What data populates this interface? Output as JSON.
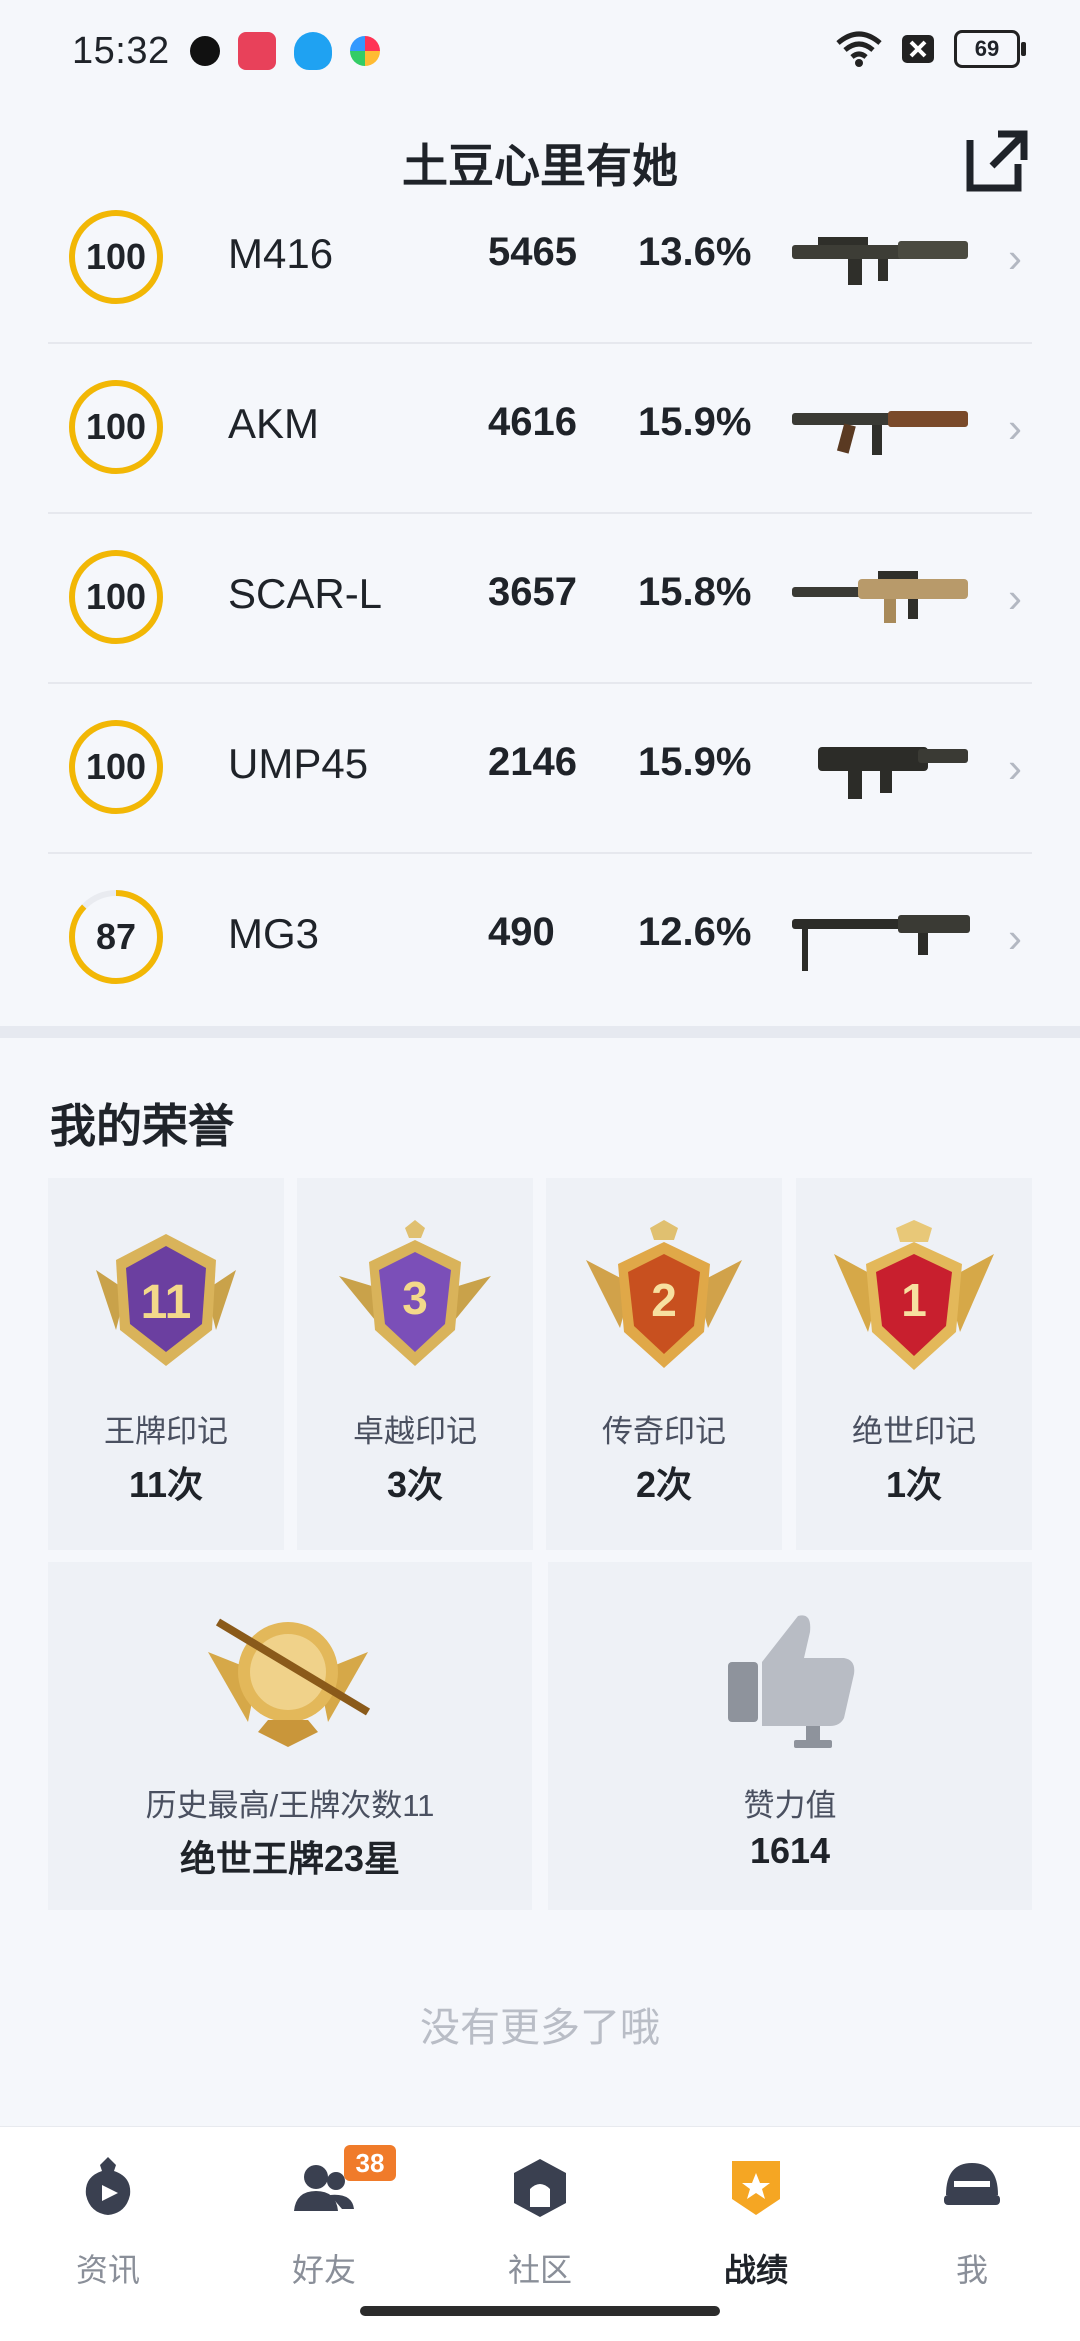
{
  "status_bar": {
    "time": "15:32",
    "battery": "69"
  },
  "header": {
    "title": "土豆心里有她"
  },
  "weapons": [
    {
      "score": "100",
      "progress": 1.0,
      "name": "M416",
      "kills": "5465",
      "rate": "13.6%"
    },
    {
      "score": "100",
      "progress": 1.0,
      "name": "AKM",
      "kills": "4616",
      "rate": "15.9%"
    },
    {
      "score": "100",
      "progress": 1.0,
      "name": "SCAR-L",
      "kills": "3657",
      "rate": "15.8%"
    },
    {
      "score": "100",
      "progress": 1.0,
      "name": "UMP45",
      "kills": "2146",
      "rate": "15.9%"
    },
    {
      "score": "87",
      "progress": 0.87,
      "name": "MG3",
      "kills": "490",
      "rate": "12.6%"
    }
  ],
  "honors": {
    "title": "我的荣誉",
    "medals": [
      {
        "label": "王牌印记",
        "count": "11次",
        "badge_num": "11",
        "color": "#6b3fa0"
      },
      {
        "label": "卓越印记",
        "count": "3次",
        "badge_num": "3",
        "color": "#7b4fb8"
      },
      {
        "label": "传奇印记",
        "count": "2次",
        "badge_num": "2",
        "color": "#c8501f"
      },
      {
        "label": "绝世印记",
        "count": "1次",
        "badge_num": "1",
        "color": "#c81f2e"
      }
    ],
    "best": {
      "label": "历史最高/王牌次数11",
      "value": "绝世王牌23星"
    },
    "likes": {
      "label": "赞力值",
      "value": "1614"
    }
  },
  "footer_text": "没有更多了哦",
  "nav": {
    "items": [
      {
        "label": "资讯"
      },
      {
        "label": "好友",
        "badge": "38"
      },
      {
        "label": "社区"
      },
      {
        "label": "战绩"
      },
      {
        "label": "我"
      }
    ]
  },
  "colors": {
    "ring": "#f2b705",
    "accent": "#f5a623",
    "badge": "#f07b2a"
  }
}
